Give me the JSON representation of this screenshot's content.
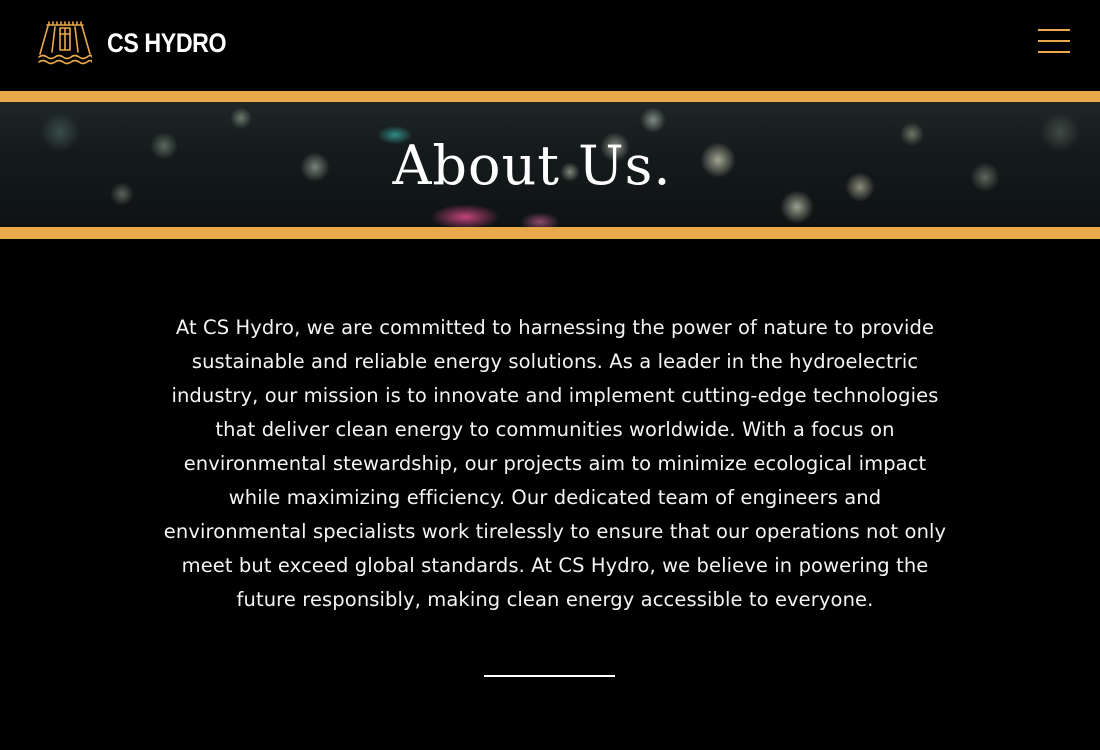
{
  "header": {
    "brand_name": "CS HYDRO",
    "logo_icon": "dam-logo-icon",
    "menu_icon": "hamburger-menu-icon",
    "accent_color": "#e8a94a"
  },
  "hero": {
    "title": "About Us.",
    "border_color": "#e8a94a"
  },
  "main": {
    "about_text": "At CS Hydro, we are committed to harnessing the power of nature to provide sustainable and reliable energy solutions. As a leader in the hydroelectric industry, our mission is to innovate and implement cutting-edge technologies that deliver clean energy to communities worldwide. With a focus on environmental stewardship, our projects aim to minimize ecological impact while maximizing efficiency. Our dedicated team of engineers and environmental specialists work tirelessly to ensure that our operations not only meet but exceed global standards. At CS Hydro, we believe in powering the future responsibly, making clean energy accessible to everyone."
  }
}
